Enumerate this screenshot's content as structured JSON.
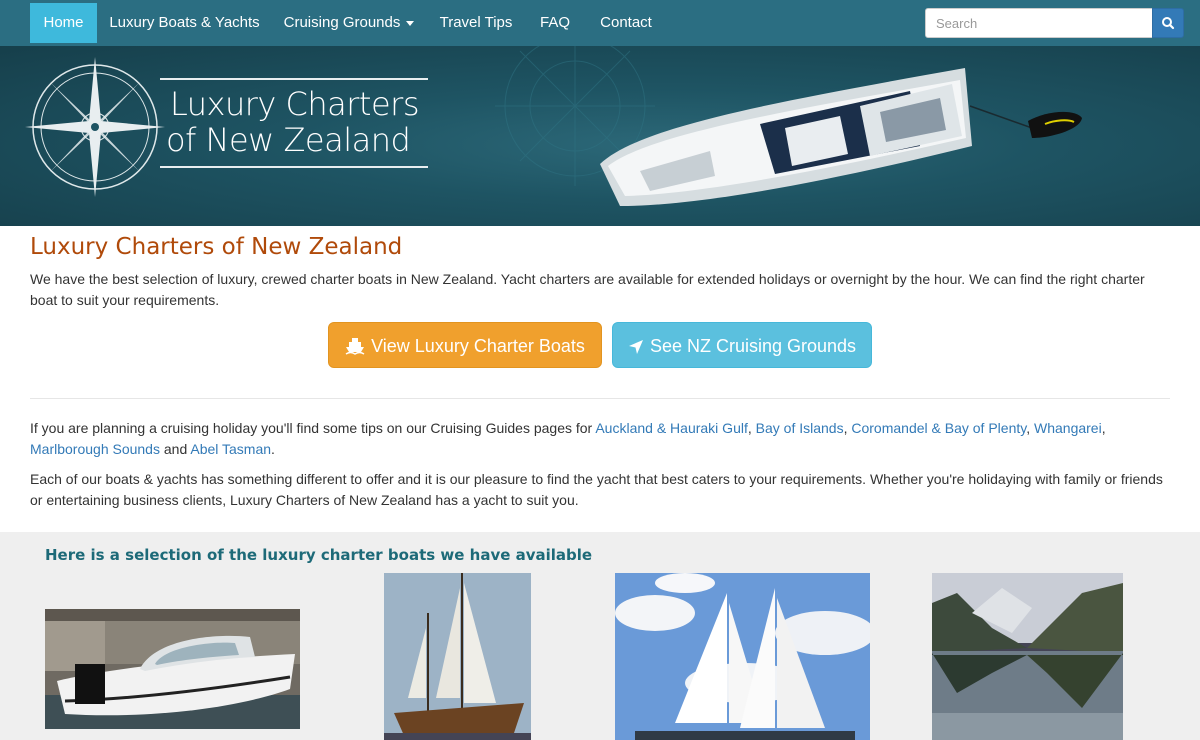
{
  "nav": {
    "home": "Home",
    "luxury": "Luxury Boats & Yachts",
    "cruising": "Cruising Grounds",
    "travel": "Travel Tips",
    "faq": "FAQ",
    "contact": "Contact"
  },
  "search": {
    "placeholder": "Search"
  },
  "banner": {
    "title_line1": "Luxury Charters",
    "title_line2": "of New Zealand"
  },
  "main": {
    "title": "Luxury Charters of New Zealand",
    "intro": "We have the best selection of luxury, crewed charter boats in New Zealand. Yacht charters are available for extended holidays or overnight by the hour. We can find the right charter boat to suit your requirements.",
    "btn_boats": "View Luxury Charter Boats",
    "btn_grounds": "See NZ Cruising Grounds",
    "guides_prefix": "If you are planning a cruising holiday you'll find some tips on our Cruising Guides pages for",
    "guides_links": [
      "Auckland & Hauraki Gulf",
      "Bay of Islands",
      "Coromandel & Bay of Plenty",
      "Whangarei",
      "Marlborough Sounds",
      "Abel Tasman"
    ],
    "guides_and": "and",
    "guides_period": ".",
    "each_para": "Each of our boats & yachts has something different to offer and it is our pleasure to find the yacht that best caters to your requirements. Whether you're holidaying with family or friends or entertaining business clients, Luxury Charters of New Zealand has a yacht to suit you."
  },
  "selection": {
    "title": "Here is a selection of the luxury charter boats we have available"
  },
  "colors": {
    "nav": "#2b6e82",
    "nav_active": "#3eb9dc",
    "title": "#b04a0a",
    "link": "#337ab7",
    "btn_orange": "#f0a02d",
    "btn_blue": "#5bc0de",
    "selection_title": "#1d6a78"
  }
}
